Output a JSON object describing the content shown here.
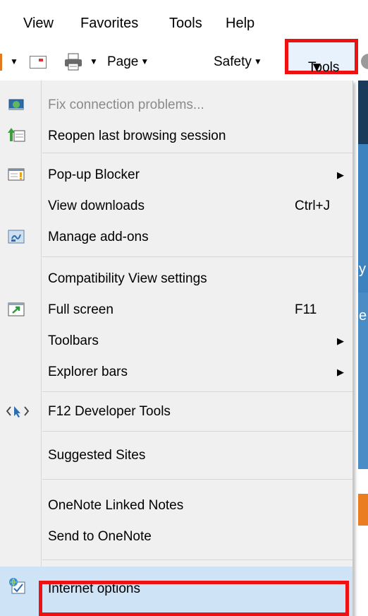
{
  "menubar": {
    "items": [
      "View",
      "Favorites",
      "Tools",
      "Help"
    ]
  },
  "commandbar": {
    "page_label": "Page",
    "safety_label": "Safety",
    "tools_label": "Tools"
  },
  "menu": {
    "fix_connection": "Fix connection problems...",
    "reopen_session": "Reopen last browsing session",
    "popup_blocker": "Pop-up Blocker",
    "view_downloads": "View downloads",
    "view_downloads_shortcut": "Ctrl+J",
    "manage_addons": "Manage add-ons",
    "compat_view": "Compatibility View settings",
    "full_screen": "Full screen",
    "full_screen_shortcut": "F11",
    "toolbars": "Toolbars",
    "explorer_bars": "Explorer bars",
    "dev_tools": "F12 Developer Tools",
    "suggested_sites": "Suggested Sites",
    "onenote_linked": "OneNote Linked Notes",
    "send_onenote": "Send to OneNote",
    "internet_options": "Internet options"
  },
  "page_background": {
    "letters": [
      "y",
      "e"
    ]
  },
  "colors": {
    "highlight_border": "#ee1111",
    "menu_bg": "#f0f0f0",
    "hover_bg": "#cfe3f7"
  }
}
